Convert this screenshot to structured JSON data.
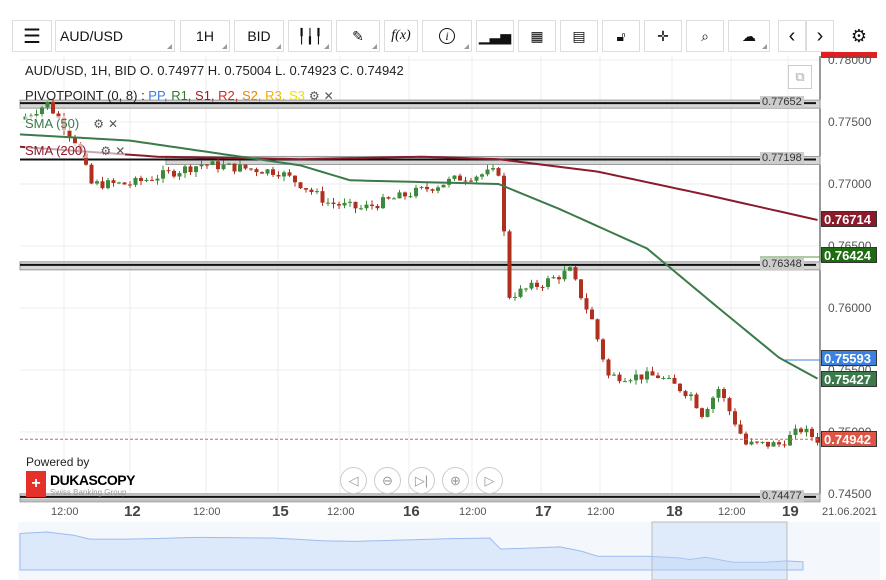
{
  "toolbar": {
    "instrument": "AUD/USD",
    "period": "1H",
    "side": "BID",
    "icons": [
      "menu-icon",
      "candlestick-icon",
      "pencil-icon",
      "function-icon",
      "info-icon",
      "bar-chart-icon",
      "calendar-icon",
      "report-icon",
      "lock-icon",
      "crosshair-icon",
      "zoom-search-icon",
      "cloud-upload-icon",
      "chevron-left-icon",
      "chevron-right-icon",
      "gear-icon"
    ],
    "fx": "f(x)",
    "info": "i"
  },
  "legend": {
    "ohlc": "AUD/USD, 1H, BID   O. 0.74977 H. 0.75004 L. 0.74923 C. 0.74942",
    "pivot_name": "PIVOTPOINT (0, 8)",
    "pivot_sep": " : ",
    "pivot_items": [
      {
        "t": "PP",
        "c": "#3b7ddd"
      },
      {
        "t": "R1",
        "c": "#2f7a2f"
      },
      {
        "t": "S1",
        "c": "#a01c1c"
      },
      {
        "t": "R2",
        "c": "#e02020"
      },
      {
        "t": "S2",
        "c": "#f08000"
      },
      {
        "t": "R3",
        "c": "#f0b000"
      },
      {
        "t": "S3",
        "c": "#f0e000"
      }
    ],
    "sma50": "SMA (50)",
    "sma200": "SMA (200)"
  },
  "price_axis": {
    "ticks": [
      "0.78000",
      "0.77500",
      "0.77000",
      "0.76500",
      "0.76000",
      "0.75500",
      "0.75000",
      "0.74500"
    ],
    "tick_values": [
      0.78,
      0.775,
      0.77,
      0.765,
      0.76,
      0.755,
      0.75,
      0.745
    ],
    "range": [
      0.745,
      0.78
    ]
  },
  "pivot_lines": [
    {
      "label": "0.77652",
      "value": 0.77652
    },
    {
      "label": "0.77198",
      "value": 0.77198
    },
    {
      "label": "0.76348",
      "value": 0.76348
    },
    {
      "label": "0.74477",
      "value": 0.74477
    }
  ],
  "tags": [
    {
      "label": "0.76714",
      "value": 0.76714,
      "color": "#8b1a2b"
    },
    {
      "label": "0.76424",
      "value": 0.76424,
      "color": "#1f6b12"
    },
    {
      "label": "0.75593",
      "value": 0.75593,
      "color": "#3b82e0"
    },
    {
      "label": "0.75427",
      "value": 0.75427,
      "color": "#3b7a4a"
    },
    {
      "label": "0.74942",
      "value": 0.74942,
      "color": "#dd5544"
    }
  ],
  "time_axis": {
    "labels": [
      {
        "t": "12:00",
        "b": false
      },
      {
        "t": "12",
        "b": true
      },
      {
        "t": "12:00",
        "b": false
      },
      {
        "t": "15",
        "b": true
      },
      {
        "t": "12:00",
        "b": false
      },
      {
        "t": "16",
        "b": true
      },
      {
        "t": "12:00",
        "b": false
      },
      {
        "t": "17",
        "b": true
      },
      {
        "t": "12:00",
        "b": false
      },
      {
        "t": "18",
        "b": true
      },
      {
        "t": "12:00",
        "b": false
      },
      {
        "t": "19",
        "b": true
      }
    ],
    "end_date": "21.06.2021"
  },
  "price_path": [
    [
      0,
      0.7752
    ],
    [
      5,
      0.7765
    ],
    [
      10,
      0.7735
    ],
    [
      13,
      0.77
    ],
    [
      20,
      0.77
    ],
    [
      33,
      0.7716
    ],
    [
      47,
      0.771
    ],
    [
      51,
      0.77
    ],
    [
      56,
      0.7685
    ],
    [
      62,
      0.768
    ],
    [
      73,
      0.7695
    ],
    [
      80,
      0.7705
    ],
    [
      87,
      0.771
    ],
    [
      89,
      0.761
    ],
    [
      95,
      0.762
    ],
    [
      100,
      0.763
    ],
    [
      104,
      0.759
    ],
    [
      107,
      0.7545
    ],
    [
      116,
      0.7545
    ],
    [
      122,
      0.753
    ],
    [
      124,
      0.7515
    ],
    [
      127,
      0.7535
    ],
    [
      132,
      0.749
    ],
    [
      138,
      0.749
    ],
    [
      142,
      0.7502
    ],
    [
      145,
      0.7494
    ]
  ],
  "sma200": [
    [
      0,
      0.773
    ],
    [
      25,
      0.7722
    ],
    [
      51,
      0.772
    ],
    [
      73,
      0.7722
    ],
    [
      87,
      0.772
    ],
    [
      105,
      0.771
    ],
    [
      124,
      0.7692
    ],
    [
      145,
      0.7671
    ]
  ],
  "sma50": [
    [
      0,
      0.774
    ],
    [
      20,
      0.7735
    ],
    [
      51,
      0.7715
    ],
    [
      60,
      0.7703
    ],
    [
      87,
      0.77
    ],
    [
      98,
      0.768
    ],
    [
      114,
      0.7648
    ],
    [
      127,
      0.76
    ],
    [
      138,
      0.756
    ],
    [
      145,
      0.7543
    ]
  ],
  "branding": {
    "powered": "Powered by",
    "brand": "DUKASCOPY",
    "sub": "Swiss Banking Group"
  },
  "nav": [
    "◁",
    "⊖",
    "▷|",
    "⊕",
    "▷"
  ]
}
